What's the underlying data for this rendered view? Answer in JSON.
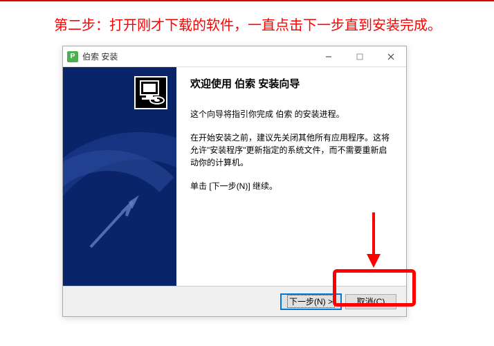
{
  "instruction": "第二步：打开刚才下载的软件，一直点击下一步直到安装完成。",
  "window": {
    "title": "伯索 安装",
    "icon_label": "P"
  },
  "content": {
    "heading": "欢迎使用 伯索 安装向导",
    "p1": "这个向导将指引你完成 伯索 的安装进程。",
    "p2": "在开始安装之前，建议先关闭其他所有应用程序。这将允许\"安装程序\"更新指定的系统文件，而不需要重新启动你的计算机。",
    "p3": "单击 [下一步(N)] 继续。"
  },
  "buttons": {
    "next": "下一步(N) >",
    "cancel": "取消(C)"
  }
}
